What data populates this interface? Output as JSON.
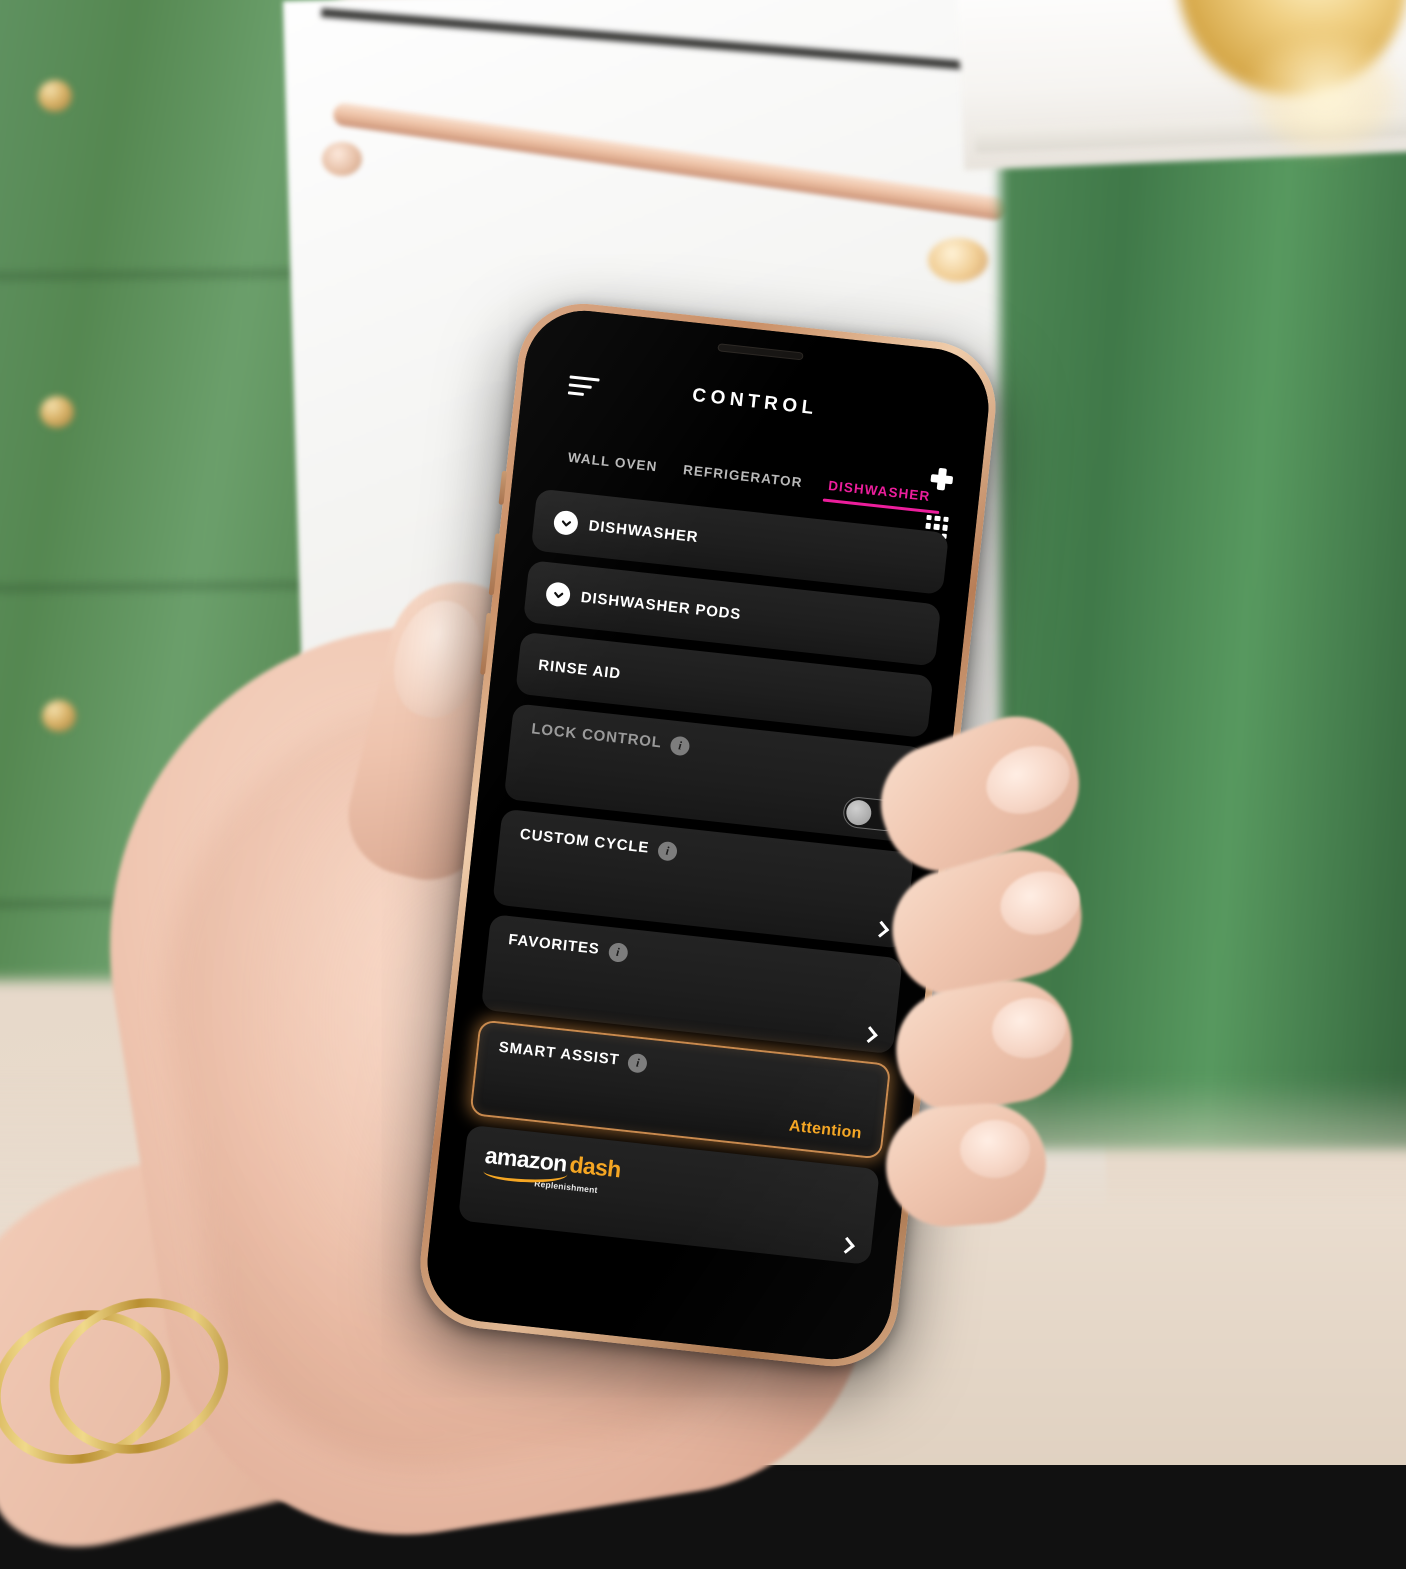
{
  "scene": {
    "description": "hand-holding-phone-in-kitchen",
    "colors": {
      "cabinet_green": "#4e8a55",
      "countertop_white": "#ffffff",
      "appliance_white": "#f4f4f2",
      "handle_copper": "#eec3a8",
      "phone_frame_gold": "#d9a886",
      "brass_gold": "#caa13f",
      "skin": "#f0c7b2"
    }
  },
  "app": {
    "header": {
      "menu_icon": "hamburger-menu-icon",
      "title": "CONTROL",
      "add_icon": "plus-icon",
      "grid_icon": "grid-apps-icon"
    },
    "tabs": [
      {
        "label": "WALL OVEN",
        "active": false
      },
      {
        "label": "REFRIGERATOR",
        "active": false
      },
      {
        "label": "DISHWASHER",
        "active": true
      }
    ],
    "accent_color": "#ec1e9c",
    "attention_color": "#f5a623",
    "rows": [
      {
        "id": "dishwasher",
        "label": "DISHWASHER",
        "leading_icon": "chevron-down-circle-icon",
        "has_info": false,
        "control": "none",
        "disabled": false
      },
      {
        "id": "dishwasher-pods",
        "label": "DISHWASHER PODS",
        "leading_icon": "chevron-down-circle-icon",
        "has_info": false,
        "control": "none",
        "disabled": false
      },
      {
        "id": "rinse-aid",
        "label": "RINSE AID",
        "leading_icon": "none",
        "has_info": false,
        "control": "none",
        "disabled": false
      },
      {
        "id": "lock-control",
        "label": "LOCK CONTROL",
        "leading_icon": "none",
        "has_info": true,
        "control": "toggle",
        "toggle_state": "off",
        "disabled": true
      },
      {
        "id": "custom-cycle",
        "label": "CUSTOM CYCLE",
        "leading_icon": "none",
        "has_info": true,
        "control": "chevron",
        "disabled": false
      },
      {
        "id": "favorites",
        "label": "FAVORITES",
        "leading_icon": "none",
        "has_info": true,
        "control": "chevron",
        "disabled": false
      },
      {
        "id": "smart-assist",
        "label": "SMART ASSIST",
        "leading_icon": "none",
        "has_info": true,
        "control": "status",
        "status_text": "Attention",
        "highlighted": true,
        "disabled": false
      }
    ],
    "amazon_dash": {
      "word_amazon": "amazon",
      "word_dash": "dash",
      "subtitle": "Replenishment",
      "control": "chevron"
    },
    "info_glyph": "i"
  }
}
